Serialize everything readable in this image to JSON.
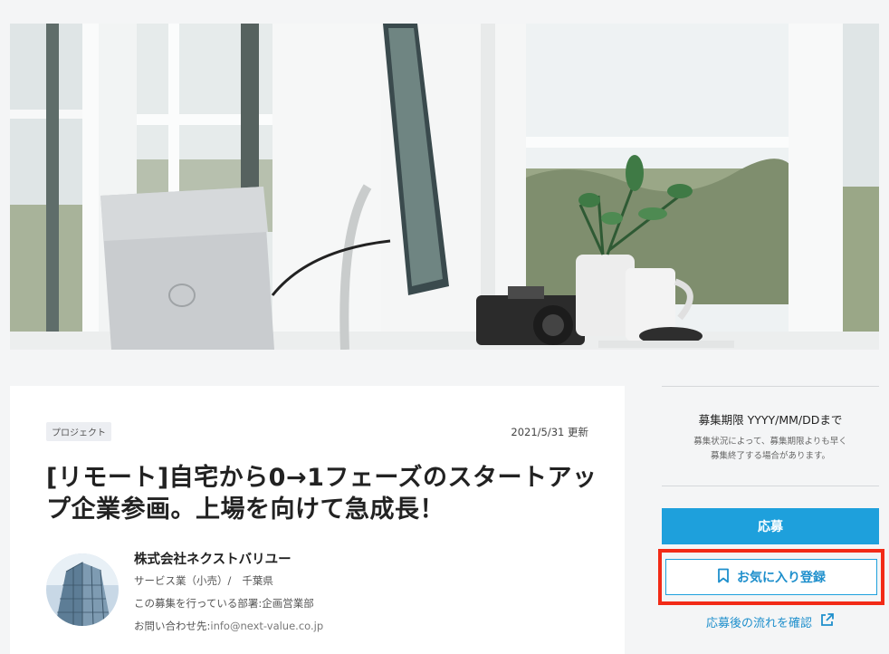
{
  "hero": {
    "alt": "desk with laptop, monitor, camera and plant by window"
  },
  "job": {
    "tag": "プロジェクト",
    "updated": "2021/5/31 更新",
    "title_line1": "[リモート]自宅から0→1フェーズのスタートアッ",
    "title_line2": "プ企業参画。上場を向けて急成長！"
  },
  "company": {
    "name": "株式会社ネクストバリユー",
    "industry": "サービス業（小売）/",
    "location": "千葉県",
    "department": "この募集を行っている部署:企画営業部",
    "contact_label": "お問い合わせ先:",
    "contact_email": "info@next-value.co.jp"
  },
  "sidebar": {
    "deadline": "募集期限  YYYY/MM/DDまで",
    "note_line1": "募集状況によって、募集期限よりも早く",
    "note_line2": "募集終了する場合があります。",
    "apply_label": "応募",
    "favorite_label": "お気に入り登録",
    "flow_link_label": "応募後の流れを確認"
  },
  "colors": {
    "accent": "#1ea0dc",
    "highlight": "#f22b17",
    "background": "#f4f5f6"
  }
}
